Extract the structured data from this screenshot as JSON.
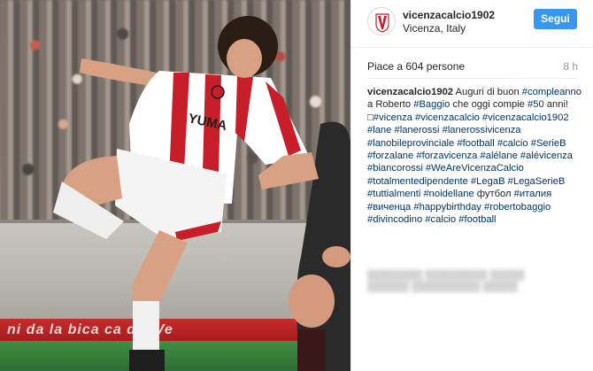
{
  "header": {
    "username": "vicenzacalcio1902",
    "location": "Vicenza, Italy",
    "follow_label": "Segui"
  },
  "stats": {
    "likes": "Piace a 604 persone",
    "time": "8 h"
  },
  "caption": {
    "author": "vicenzacalcio1902",
    "parts": [
      {
        "t": "Auguri di buon "
      },
      {
        "t": "#compleanno",
        "tag": true
      },
      {
        "t": " a Roberto "
      },
      {
        "t": "#Baggio",
        "tag": true
      },
      {
        "t": " che oggi compie "
      },
      {
        "t": "#50",
        "tag": true
      },
      {
        "t": " anni! "
      },
      {
        "t": "□",
        "tag": false
      },
      {
        "t": "#vicenza",
        "tag": true
      },
      {
        "t": " "
      },
      {
        "t": "#vicenzacalcio",
        "tag": true
      },
      {
        "t": " "
      },
      {
        "t": "#vicenzacalcio1902",
        "tag": true
      },
      {
        "t": " "
      },
      {
        "t": "#lane",
        "tag": true
      },
      {
        "t": " "
      },
      {
        "t": "#lanerossi",
        "tag": true
      },
      {
        "t": " "
      },
      {
        "t": "#lanerossivicenza",
        "tag": true
      },
      {
        "t": " "
      },
      {
        "t": "#lanobileprovinciale",
        "tag": true
      },
      {
        "t": " "
      },
      {
        "t": "#football",
        "tag": true
      },
      {
        "t": " "
      },
      {
        "t": "#calcio",
        "tag": true
      },
      {
        "t": " "
      },
      {
        "t": "#SerieB",
        "tag": true
      },
      {
        "t": " "
      },
      {
        "t": "#forzalane",
        "tag": true
      },
      {
        "t": " "
      },
      {
        "t": "#forzavicenza",
        "tag": true
      },
      {
        "t": " "
      },
      {
        "t": "#alélane",
        "tag": true
      },
      {
        "t": " "
      },
      {
        "t": "#alévicenza",
        "tag": true
      },
      {
        "t": " "
      },
      {
        "t": "#biancorossi",
        "tag": true
      },
      {
        "t": " "
      },
      {
        "t": "#WeAreVicenzaCalcio",
        "tag": true
      },
      {
        "t": " "
      },
      {
        "t": "#totalmentedipendente",
        "tag": true
      },
      {
        "t": " "
      },
      {
        "t": "#LegaB",
        "tag": true
      },
      {
        "t": " "
      },
      {
        "t": "#LegaSerieB",
        "tag": true
      },
      {
        "t": " "
      },
      {
        "t": "#tuttialmenti",
        "tag": true
      },
      {
        "t": " "
      },
      {
        "t": "#noidellane",
        "tag": true
      },
      {
        "t": " футбол "
      },
      {
        "t": "#италия",
        "tag": true
      },
      {
        "t": " "
      },
      {
        "t": "#виченца",
        "tag": true
      },
      {
        "t": " "
      },
      {
        "t": "#happybirthday",
        "tag": true
      },
      {
        "t": " "
      },
      {
        "t": "#robertobaggio",
        "tag": true
      },
      {
        "t": " "
      },
      {
        "t": "#divincodino",
        "tag": true
      },
      {
        "t": " "
      },
      {
        "t": "#calcio",
        "tag": true
      },
      {
        "t": " "
      },
      {
        "t": "#football",
        "tag": true
      }
    ]
  },
  "photo": {
    "shirt_text": "YUMA",
    "adboard_text": "ni da la bica ca del Ve"
  },
  "colors": {
    "follow_button": "#3897f0",
    "hashtag": "#003569",
    "shirt_red": "#c81e2a",
    "adboard_red": "#b8201f"
  },
  "icons": {
    "avatar": "vicenza-calcio-logo-icon"
  }
}
